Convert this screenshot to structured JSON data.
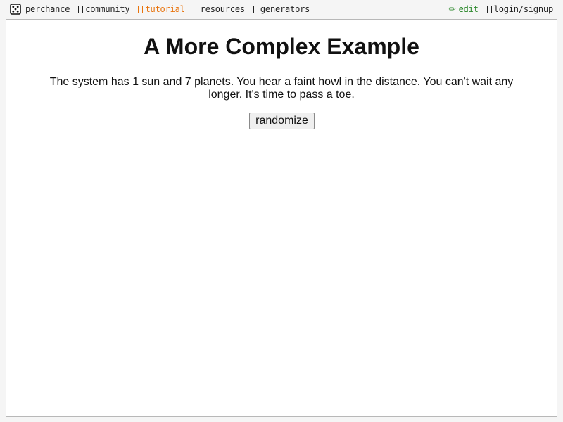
{
  "nav": {
    "brand": {
      "label": "perchance",
      "icon": "dice-icon"
    },
    "items": [
      {
        "label": "community",
        "icon": "box-icon"
      },
      {
        "label": "tutorial",
        "icon": "box-icon",
        "color": "#e8730c"
      },
      {
        "label": "resources",
        "icon": "box-icon"
      },
      {
        "label": "generators",
        "icon": "box-icon"
      }
    ],
    "right": [
      {
        "label": "edit",
        "icon": "pencil-icon",
        "color": "#2f8a2f"
      },
      {
        "label": "login/signup",
        "icon": "box-icon"
      }
    ]
  },
  "main": {
    "title": "A More Complex Example",
    "output": "The system has 1 sun and 7 planets. You hear a faint howl in the distance. You can't wait any longer. It's time to pass a toe.",
    "button_label": "randomize"
  }
}
